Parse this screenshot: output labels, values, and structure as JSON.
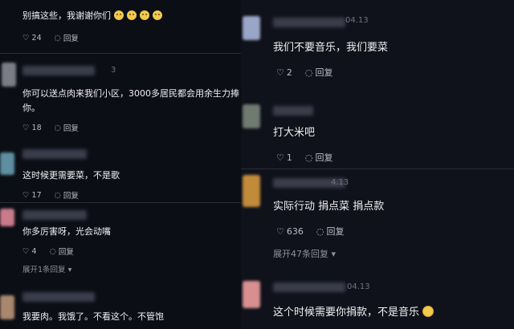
{
  "left": {
    "comments": [
      {
        "text": "别搞这些，我谢谢你们",
        "likes": "24",
        "reply_label": "回复"
      },
      {
        "date": "3",
        "text_line1": "你可以送点肉来我们小区，3000多居民都会用余生力捧",
        "text_line2": "你。",
        "likes": "18",
        "reply_label": "回复"
      },
      {
        "text": "这时候更需要菜，不是歌",
        "likes": "17",
        "reply_label": "回复"
      },
      {
        "text": "你多厉害呀，光会动嘴",
        "likes": "4",
        "reply_label": "回复",
        "expand": "展开1条回复"
      },
      {
        "text": "我要肉。我饿了。不看这个。不管饱"
      }
    ]
  },
  "right": {
    "comments": [
      {
        "date": "04.13",
        "text": "我们不要音乐，我们要菜",
        "likes": "2",
        "reply_label": "回复"
      },
      {
        "text": "打大米吧",
        "likes": "1",
        "reply_label": "回复"
      },
      {
        "date": "4.13",
        "text": "实际行动 捐点菜 捐点款",
        "likes": "636",
        "reply_label": "回复",
        "expand": "展开47条回复"
      },
      {
        "date": "04.13",
        "text": "这个时候需要你捐款，不是音乐"
      }
    ]
  },
  "colors": {
    "background": "#0b0d14",
    "text": "#f0f0f2",
    "muted": "#b9bcc6"
  },
  "icons": {
    "like": "heart-outline-icon",
    "reply": "speech-bubble-icon",
    "expand": "caret-down-icon"
  }
}
